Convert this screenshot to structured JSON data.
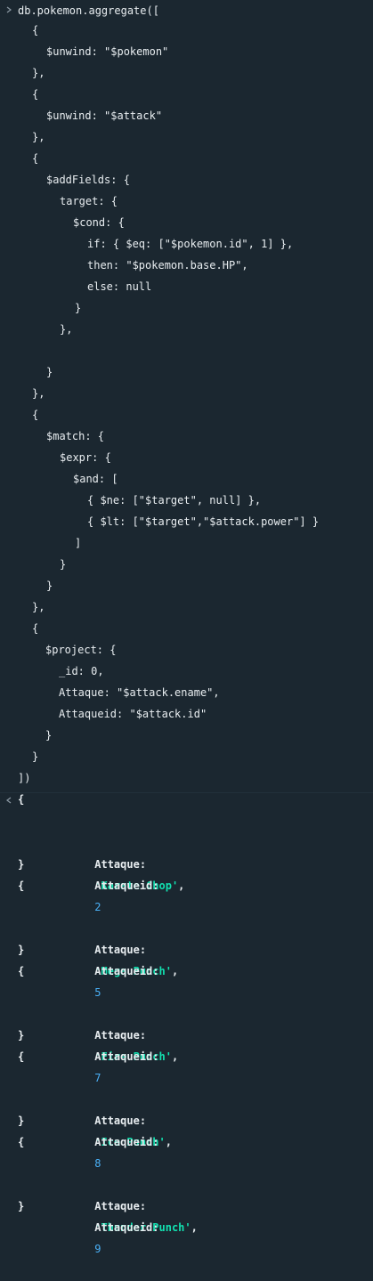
{
  "input": {
    "prompt_icon": "chevron-right-icon",
    "lines": [
      "db.pokemon.aggregate([",
      "{",
      "$unwind: \"$pokemon\"",
      "},",
      "{",
      "$unwind: \"$attack\"",
      "},",
      "{",
      "$addFields: {",
      "target: {",
      "$cond: {",
      "if: { $eq: [\"$pokemon.id\", 1] },",
      "then: \"$pokemon.base.HP\",",
      "else: null",
      "}",
      "},",
      "",
      "}",
      "},",
      "{",
      "$match: {",
      "$expr: {",
      "$and: [",
      "{ $ne: [\"$target\", null] },",
      "{ $lt: [\"$target\",\"$attack.power\"] }",
      "]",
      "}",
      "}",
      "},",
      "{",
      "$project: {",
      "_id: 0,",
      "Attaque: \"$attack.ename\",",
      "Attaqueid: \"$attack.id\"",
      "}",
      "}",
      "])"
    ]
  },
  "output": {
    "result_icon": "chevron-left-icon",
    "documents": [
      {
        "open": "{",
        "attaque_key": "Attaque:",
        "attaque_value": "'Karate Chop'",
        "comma": ",",
        "id_key": "Attaqueid:",
        "id_value": "2",
        "close": "}"
      },
      {
        "open": "{",
        "attaque_key": "Attaque:",
        "attaque_value": "'Mega Punch'",
        "comma": ",",
        "id_key": "Attaqueid:",
        "id_value": "5",
        "close": "}"
      },
      {
        "open": "{",
        "attaque_key": "Attaque:",
        "attaque_value": "'Fire Punch'",
        "comma": ",",
        "id_key": "Attaqueid:",
        "id_value": "7",
        "close": "}"
      },
      {
        "open": "{",
        "attaque_key": "Attaque:",
        "attaque_value": "'Ice Punch'",
        "comma": ",",
        "id_key": "Attaqueid:",
        "id_value": "8",
        "close": "}"
      },
      {
        "open": "{",
        "attaque_key": "Attaque:",
        "attaque_value": "'Thunder Punch'",
        "comma": ",",
        "id_key": "Attaqueid:",
        "id_value": "9",
        "close": "}"
      }
    ]
  },
  "colors": {
    "background": "#1b2730",
    "text": "#e8edf0",
    "string": "#12e0b0",
    "number": "#4ab0f6",
    "prompt": "#8b98a3"
  }
}
